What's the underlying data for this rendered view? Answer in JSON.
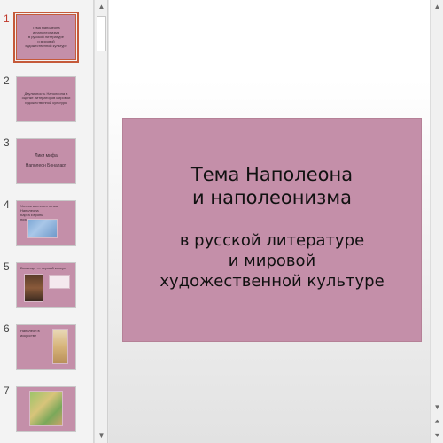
{
  "thumbnails": [
    {
      "number": "1",
      "text": "Тема Наполеона\nи наполеонизма\nв русской литературе\nи мировой\nхудожественной культуре"
    },
    {
      "number": "2",
      "text": "Двуличность Наполеона в оценке литераторов мировой художественной культуры"
    },
    {
      "number": "3",
      "text": "Лики мифа\nНаполеон Бонапарт"
    },
    {
      "number": "4",
      "text": "Успехи военного гения Наполеона\nКарта Европы\nпоходы"
    },
    {
      "number": "5",
      "text": "Бонапарт — первый консул"
    },
    {
      "number": "6",
      "text": "Наполеон в искусстве"
    },
    {
      "number": "7",
      "text": ""
    }
  ],
  "slide": {
    "title": "Тема Наполеона\nи наполеонизма",
    "subtitle": "в русской литературе\nи мировой\nхудожественной культуре"
  },
  "colors": {
    "slide_background": "#c48fa9",
    "selection_outline": "#c55a3a",
    "active_number": "#c0392b"
  }
}
